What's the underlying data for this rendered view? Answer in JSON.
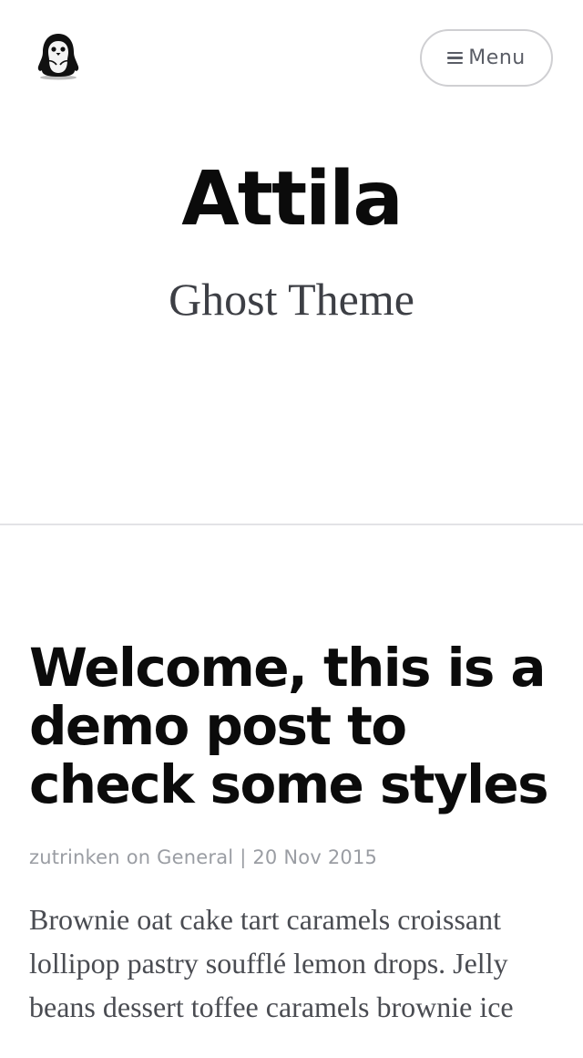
{
  "header": {
    "logo_icon": "penguin-logo-icon",
    "menu_icon": "hamburger-menu-icon",
    "menu_label": "Menu"
  },
  "hero": {
    "title": "Attila",
    "subtitle": "Ghost Theme"
  },
  "post": {
    "title": "Welcome, this is a demo post to check some styles",
    "author": "zutrinken",
    "on_text": "on",
    "category": "General",
    "separator": "|",
    "date": "20 Nov 2015",
    "excerpt": "Brownie oat cake tart caramels croissant lollipop pastry soufflé lemon drops. Jelly beans dessert toffee caramels brownie ice"
  },
  "colors": {
    "title": "#0b0b0b",
    "subtitle": "#3d3f45",
    "meta": "#9a9da3",
    "excerpt": "#4a4c52",
    "menu_border": "#cfcfd2",
    "divider": "#e3e3e6"
  }
}
